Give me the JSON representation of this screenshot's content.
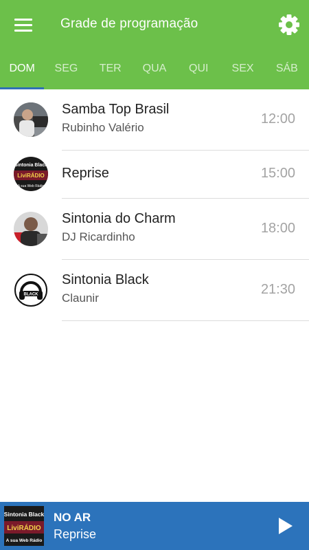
{
  "header": {
    "title": "Grade de programação",
    "menu_icon": "menu-icon",
    "settings_icon": "gear-icon",
    "color": "#6cc04a",
    "indicator_color": "#2f6fb5"
  },
  "tabs": [
    {
      "label": "DOM",
      "active": true
    },
    {
      "label": "SEG",
      "active": false
    },
    {
      "label": "TER",
      "active": false
    },
    {
      "label": "QUA",
      "active": false
    },
    {
      "label": "QUI",
      "active": false
    },
    {
      "label": "SEX",
      "active": false
    },
    {
      "label": "SÁB",
      "active": false
    }
  ],
  "schedule": [
    {
      "title": "Samba Top Brasil",
      "host": "Rubinho Valério",
      "time": "12:00",
      "avatar": "host-photo"
    },
    {
      "title": "Reprise",
      "host": "",
      "time": "15:00",
      "avatar": "sintonia-black-logo",
      "logo_lines": [
        "Sintonia Black",
        "LiviRÁDIO",
        "A sua Web Rádio"
      ]
    },
    {
      "title": "Sintonia do Charm",
      "host": "DJ Ricardinho",
      "time": "18:00",
      "avatar": "host-photo"
    },
    {
      "title": "Sintonia Black",
      "host": "Claunir",
      "time": "21:30",
      "avatar": "headphones-logo",
      "logo_lines": [
        "BLACK"
      ]
    }
  ],
  "player": {
    "label": "NO AR",
    "program": "Reprise",
    "logo_lines": [
      "Sintonia Black",
      "LiviRÁDIO",
      "A sua Web Rádio"
    ],
    "play_icon": "play-icon",
    "color": "#2c73bb"
  }
}
